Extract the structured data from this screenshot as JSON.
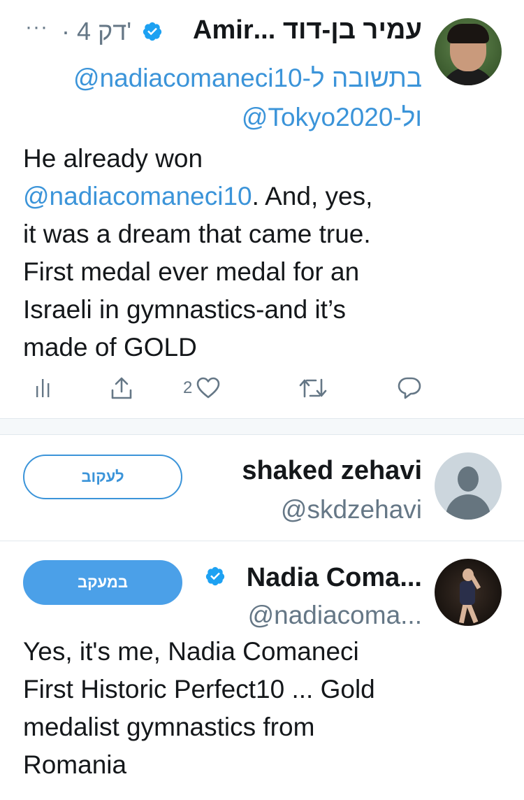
{
  "tweet": {
    "author_name": "עמיר בן-דוד ...Amir",
    "time": "4 דק'",
    "time_separator": "·",
    "more": "···",
    "reply_prefix": "בתשובה ל-",
    "reply_handle_1": "@nadiacomaneci10",
    "reply_conjunction": "ול-",
    "reply_handle_2": "@Tokyo2020",
    "body": {
      "line_1": "He already won",
      "mention": "@nadiacomaneci10",
      "line_2_rest": ". And, yes,",
      "line_3": "it was a dream that came true.",
      "line_4": "First medal ever medal for an",
      "line_5": "Israeli in gymnastics-and it’s",
      "line_6": "made of GOLD"
    },
    "like_count": "2",
    "icons": {
      "analytics": "analytics-icon",
      "share": "share-icon",
      "like": "heart-icon",
      "retweet": "retweet-icon",
      "reply": "reply-icon",
      "verified": "verified-badge-icon"
    }
  },
  "users": [
    {
      "name": "shaked zehavi",
      "handle": "@skdzehavi",
      "button": "לעקוב"
    },
    {
      "name": "Nadia Coma...",
      "handle": "@nadiacoma...",
      "button": "במעקב",
      "bio": {
        "line_1": "Yes, it's me, Nadia Comaneci",
        "line_2": "First Historic Perfect10 ... Gold",
        "line_3": "medalist gymnastics from",
        "line_4": "Romania"
      }
    }
  ],
  "colors": {
    "accent": "#1da1f2",
    "link": "#3b94d9",
    "secondary_text": "#657786",
    "divider": "#e1e8ed"
  }
}
